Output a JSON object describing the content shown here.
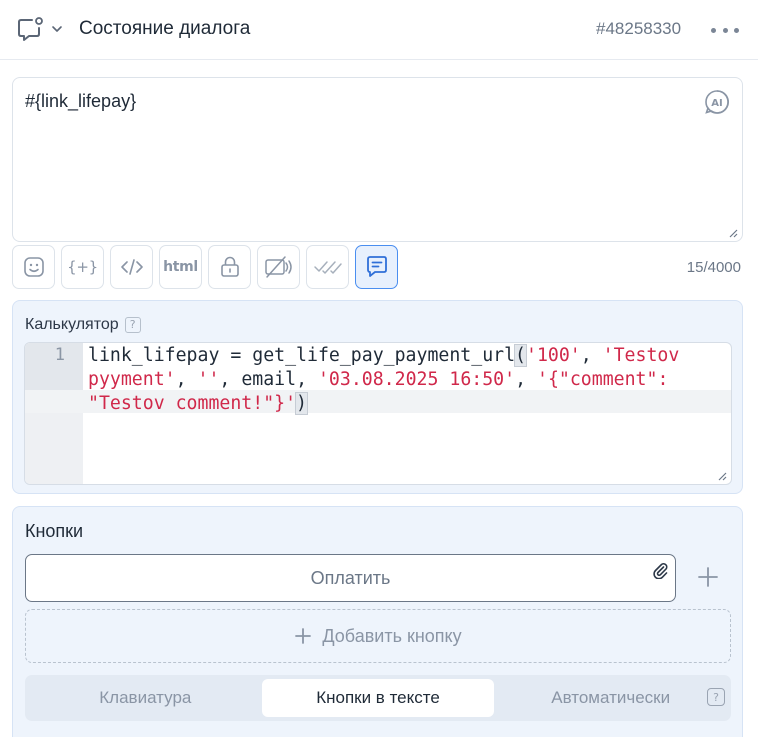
{
  "header": {
    "title": "Состояние диалога",
    "dialog_id": "#48258330",
    "icons": [
      "chat-bubble-icon",
      "chevron-down-icon",
      "more-dots-icon"
    ]
  },
  "message": {
    "text": "#{link_lifepay}",
    "ai_label": "AI",
    "counter": "15/4000"
  },
  "toolbar": {
    "buttons": [
      "emoji-icon",
      "variable-icon",
      "code-icon",
      "html-button",
      "lock-icon",
      "no-preview-icon",
      "read-receipt-icon",
      "comment-icon"
    ],
    "html_label": "html",
    "variable_label": "{+}",
    "active_button": "comment-icon"
  },
  "calculator": {
    "label": "Калькулятор",
    "help": "?",
    "line_number": "1",
    "code": {
      "p1": "link_lifepay = get_life_pay_payment_url",
      "open_paren": "(",
      "s1": "'100'",
      "c1": ", ",
      "s2a": "'Testov",
      "s2b": "pyyment'",
      "c2": ", ",
      "s3": "''",
      "c3": ", email, ",
      "s4": "'03.08.2025 16:50'",
      "c4": ", ",
      "s5a": "'{\"comment\":",
      "s5b": "\"Testov comment!\"}'",
      "close_paren": ")"
    }
  },
  "buttons_panel": {
    "title": "Кнопки",
    "button_label": "Оплатить",
    "add_button_label": "Добавить кнопку",
    "modes": [
      "Клавиатура",
      "Кнопки в тексте",
      "Автоматически"
    ],
    "active_mode": "Кнопки в тексте",
    "help": "?"
  },
  "colors": {
    "accent": "#4a8ef0",
    "string": "#d0284a",
    "panel_bg": "#eef4fc"
  }
}
